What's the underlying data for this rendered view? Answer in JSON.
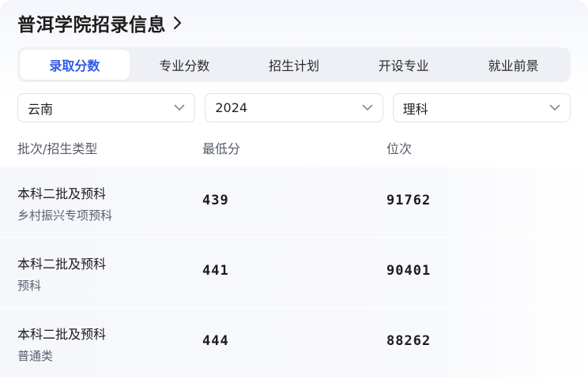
{
  "header": {
    "title": "普洱学院招录信息",
    "chevron_icon": "chevron-right-icon"
  },
  "tabs": [
    {
      "label": "录取分数",
      "active": true
    },
    {
      "label": "专业分数",
      "active": false
    },
    {
      "label": "招生计划",
      "active": false
    },
    {
      "label": "开设专业",
      "active": false
    },
    {
      "label": "就业前景",
      "active": false
    }
  ],
  "filters": {
    "province": "云南",
    "year": "2024",
    "subject": "理科",
    "caret_icon": "chevron-down-icon"
  },
  "table": {
    "columns": [
      "批次/招生类型",
      "最低分",
      "位次"
    ],
    "rows": [
      {
        "batch": "本科二批及预科",
        "type": "乡村振兴专项预科",
        "min_score": "439",
        "rank": "91762"
      },
      {
        "batch": "本科二批及预科",
        "type": "预科",
        "min_score": "441",
        "rank": "90401"
      },
      {
        "batch": "本科二批及预科",
        "type": "普通类",
        "min_score": "444",
        "rank": "88262"
      }
    ]
  },
  "colors": {
    "accent": "#2f58e8",
    "tab_bg": "#eef0f5",
    "row_bg": "#f6f7fb"
  }
}
